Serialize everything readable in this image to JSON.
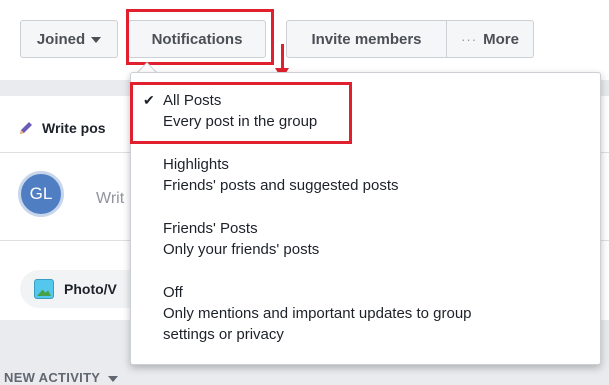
{
  "toolbar": {
    "joined_label": "Joined",
    "notifications_label": "Notifications",
    "invite_label": "Invite members",
    "more_dots": "···",
    "more_label": "More"
  },
  "composer": {
    "write_tab_label": "Write pos",
    "avatar_initials": "GL",
    "placeholder": "Writ",
    "photo_label": "Photo/V",
    "side_dots": "··"
  },
  "activity": {
    "label": "NEW ACTIVITY"
  },
  "menu": {
    "items": [
      {
        "title": "All Posts",
        "desc": "Every post in the group",
        "selected": true,
        "check": "✔"
      },
      {
        "title": "Highlights",
        "desc": "Friends' posts and suggested posts"
      },
      {
        "title": "Friends' Posts",
        "desc": "Only your friends' posts"
      },
      {
        "title": "Off",
        "desc": "Only mentions and important updates to group",
        "desc2": "settings or privacy"
      }
    ]
  },
  "colors": {
    "highlight": "#e0202f",
    "accent": "#4f7fc2"
  }
}
